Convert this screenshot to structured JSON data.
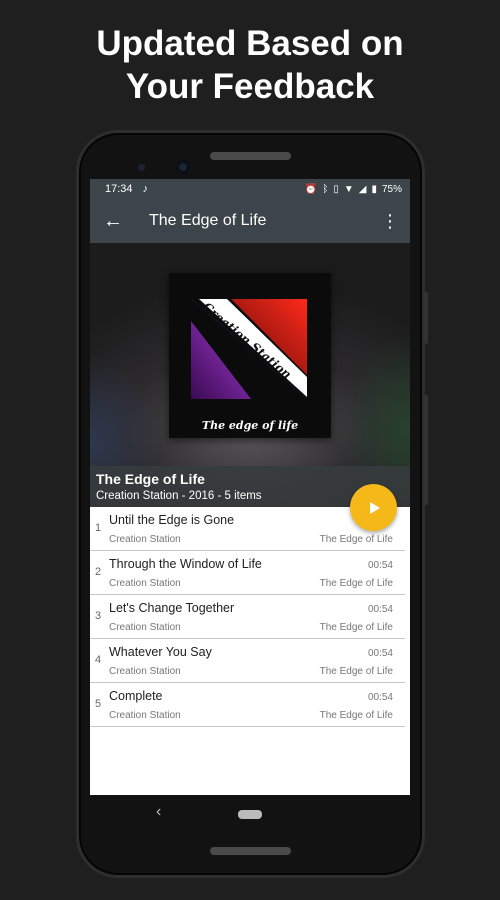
{
  "promo": {
    "headline_line1": "Updated Based on",
    "headline_line2": "Your Feedback"
  },
  "status_bar": {
    "time": "17:34",
    "battery": "75%"
  },
  "app_bar": {
    "title": "The Edge of Life"
  },
  "album": {
    "title": "The Edge of Life",
    "meta": "Creation Station - 2016 - 5 items",
    "cover_artist_text": "Creation Station",
    "cover_title_text": "The edge of life"
  },
  "tracks": [
    {
      "number": "1",
      "title": "Until the Edge is Gone",
      "artist": "Creation Station",
      "duration": "",
      "album": "The Edge of Life"
    },
    {
      "number": "2",
      "title": "Through the Window of Life",
      "artist": "Creation Station",
      "duration": "00:54",
      "album": "The Edge of Life"
    },
    {
      "number": "3",
      "title": "Let's Change Together",
      "artist": "Creation Station",
      "duration": "00:54",
      "album": "The Edge of Life"
    },
    {
      "number": "4",
      "title": "Whatever You Say",
      "artist": "Creation Station",
      "duration": "00:54",
      "album": "The Edge of Life"
    },
    {
      "number": "5",
      "title": "Complete",
      "artist": "Creation Station",
      "duration": "00:54",
      "album": "The Edge of Life"
    }
  ],
  "colors": {
    "accent": "#f5b819",
    "toolbar": "#3c4549",
    "background": "#1f1f1f"
  }
}
